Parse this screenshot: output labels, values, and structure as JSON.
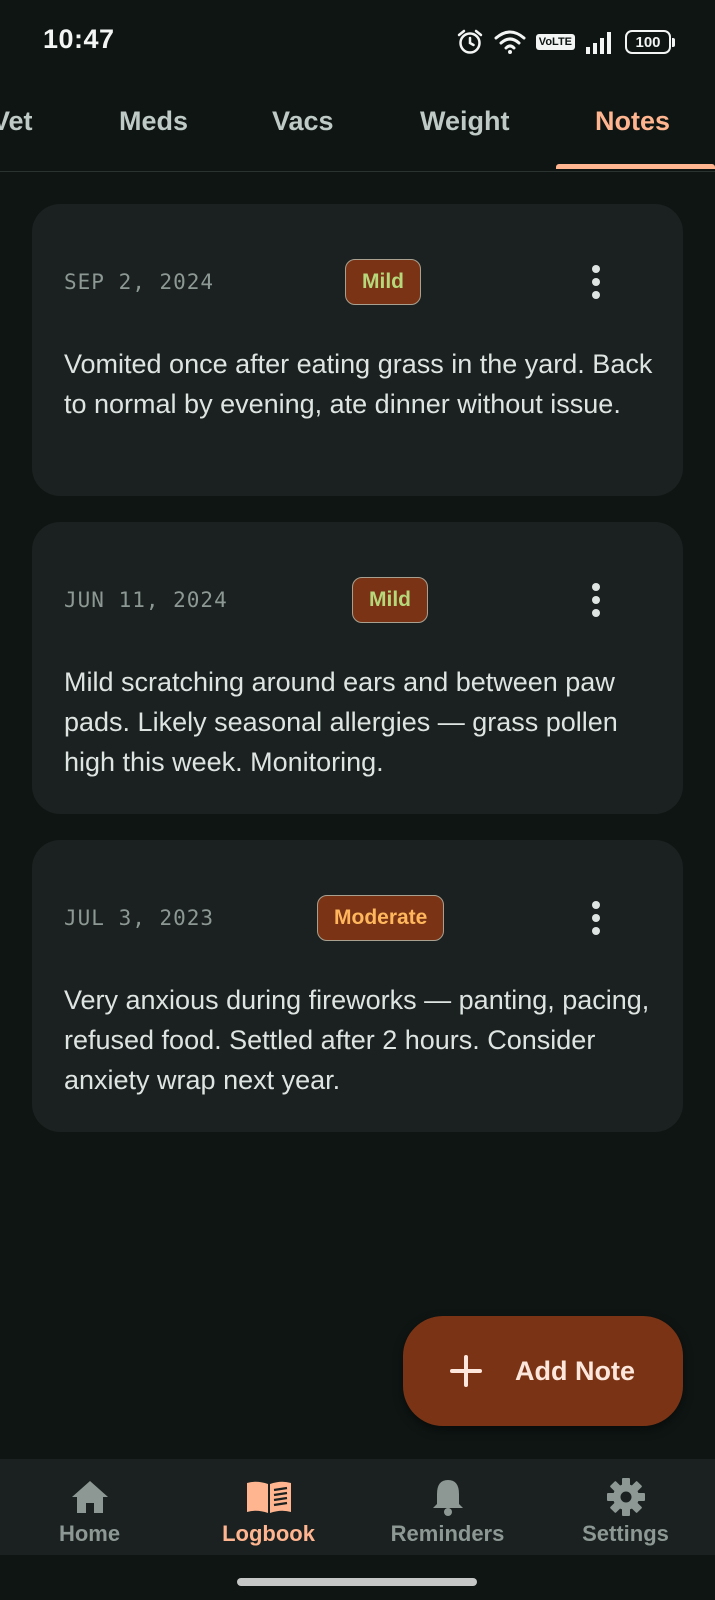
{
  "status_bar": {
    "time": "10:47",
    "volte": "VoLTE",
    "battery": "100"
  },
  "tabs": [
    {
      "label": "Vet",
      "active": false
    },
    {
      "label": "Meds",
      "active": false
    },
    {
      "label": "Vacs",
      "active": false
    },
    {
      "label": "Weight",
      "active": false
    },
    {
      "label": "Notes",
      "active": true
    }
  ],
  "notes": [
    {
      "date": "SEP 2, 2024",
      "severity": "Mild",
      "text": "Vomited once after eating grass in the yard. Back to normal by evening, ate dinner without issue."
    },
    {
      "date": "JUN 11, 2024",
      "severity": "Mild",
      "text": "Mild scratching around ears and between paw pads. Likely seasonal allergies — grass pollen high this week. Monitoring."
    },
    {
      "date": "JUL 3, 2023",
      "severity": "Moderate",
      "text": "Very anxious during fireworks — panting, pacing, refused food. Settled after 2 hours. Consider anxiety wrap next year."
    }
  ],
  "fab": {
    "label": "Add Note",
    "icon": "plus-icon"
  },
  "bottom_nav": [
    {
      "label": "Home",
      "icon": "home-icon",
      "active": false
    },
    {
      "label": "Logbook",
      "icon": "book-icon",
      "active": true
    },
    {
      "label": "Reminders",
      "icon": "bell-icon",
      "active": false
    },
    {
      "label": "Settings",
      "icon": "gear-icon",
      "active": false
    }
  ],
  "colors": {
    "background": "#0e1513",
    "card": "#1a2120",
    "accent": "#ffb58f",
    "badge_bg": "#7a3415",
    "mild": "#b6d77a",
    "moderate": "#ffb65c"
  }
}
